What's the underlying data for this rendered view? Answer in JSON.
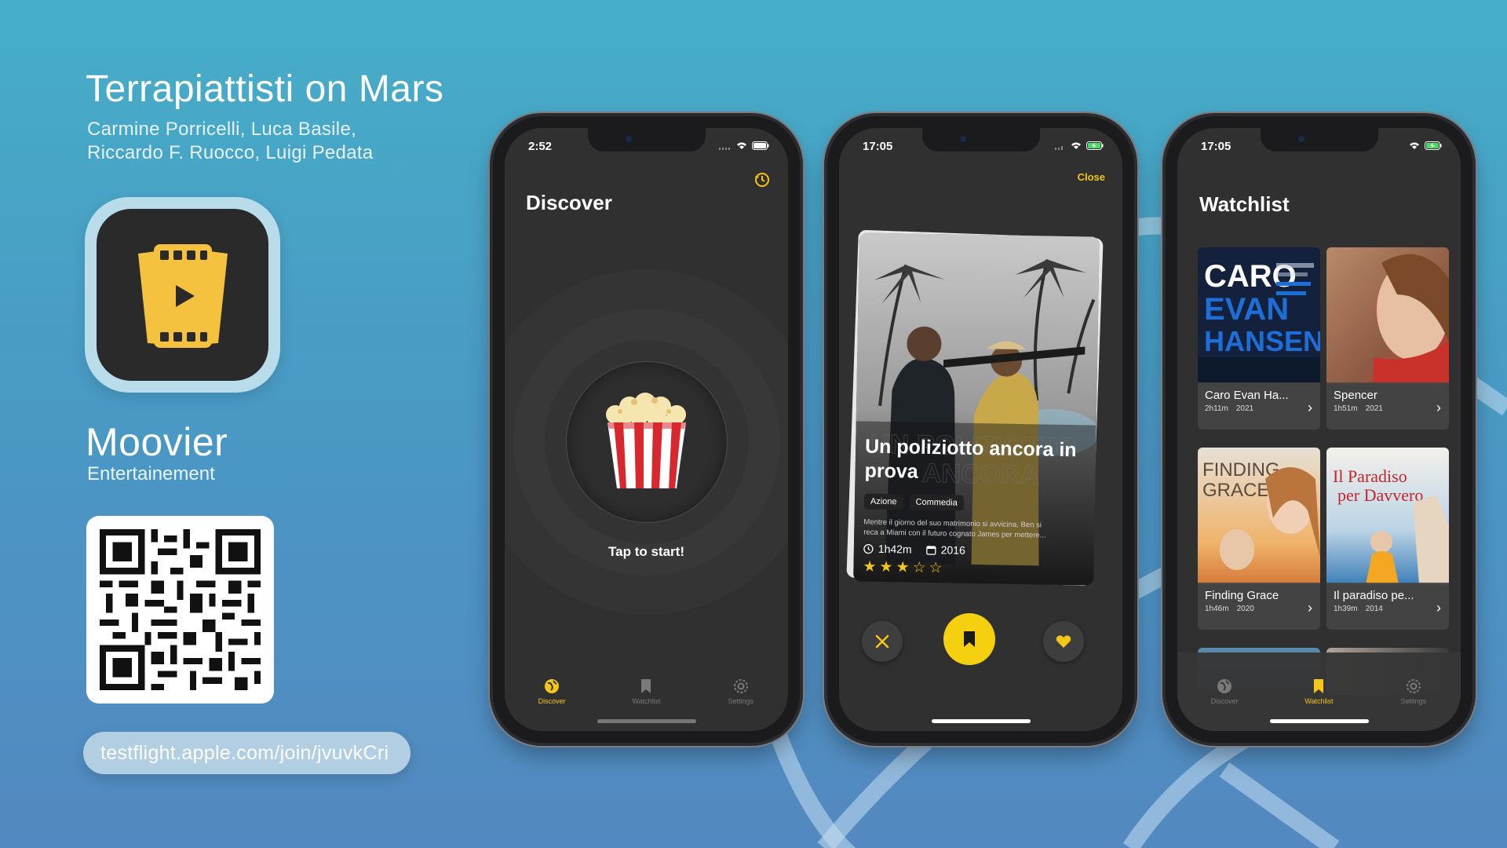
{
  "team": {
    "title": "Terrapiattisti on Mars",
    "members_line1": "Carmine Porricelli, Luca Basile,",
    "members_line2": "Riccardo F. Ruocco, Luigi Pedata"
  },
  "app": {
    "name": "Moovier",
    "category": "Entertainement",
    "link": "testflight.apple.com/join/jvuvkCri"
  },
  "colors": {
    "accent": "#f5c518",
    "screen_bg": "#303030"
  },
  "screens": {
    "discover": {
      "time": "2:52",
      "title": "Discover",
      "tap_label": "Tap to start!"
    },
    "detail": {
      "time": "17:05",
      "close": "Close",
      "movie_title": "Un poliziotto ancora in prova",
      "genres": [
        "Azione",
        "Commedia"
      ],
      "plot_line1": "Mentre il giorno del suo matrimonio si avvicina, Ben si",
      "plot_line2": "reca a Miami con il futuro cognato James per mettere...",
      "duration": "1h42m",
      "year": "2016",
      "rating": 3,
      "rating_max": 5
    },
    "watchlist": {
      "time": "17:05",
      "title": "Watchlist",
      "movies": [
        {
          "name": "Caro Evan Ha...",
          "duration": "2h11m",
          "year": "2021"
        },
        {
          "name": "Spencer",
          "duration": "1h51m",
          "year": "2021"
        },
        {
          "name": "Finding Grace",
          "duration": "1h46m",
          "year": "2020"
        },
        {
          "name": "Il paradiso pe...",
          "duration": "1h39m",
          "year": "2014"
        }
      ],
      "posters": {
        "p1_line1": "CARO",
        "p1_line2": "EVAN",
        "p1_line3": "HANSEN",
        "p3_line1": "FINDING",
        "p3_line2": "GRACE",
        "p4_line1": "Il Paradiso",
        "p4_line2": "per Davvero"
      }
    }
  },
  "tabs": {
    "discover": "Discover",
    "watchlist": "Watchlist",
    "settings": "Settings"
  }
}
